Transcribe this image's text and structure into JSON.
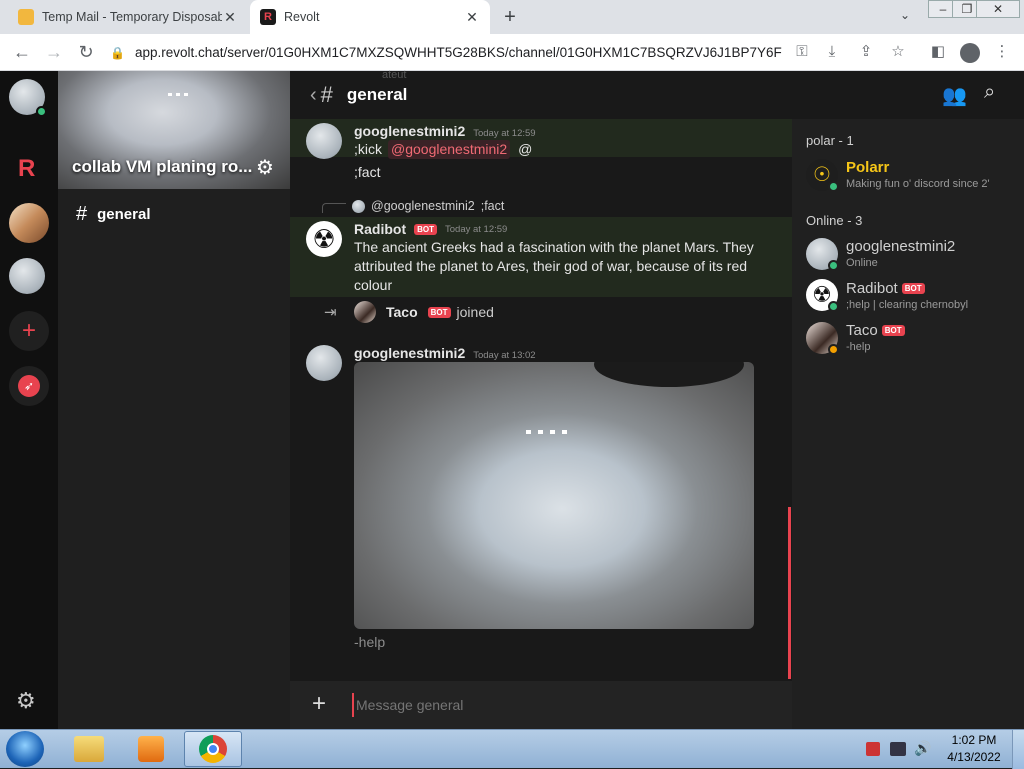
{
  "browser": {
    "tabs": [
      {
        "title": "Temp Mail - Temporary Disposable",
        "active": false
      },
      {
        "title": "Revolt",
        "active": true
      }
    ],
    "url": "app.revolt.chat/server/01G0HXM1C7MXZSQWHHT5G28BKS/channel/01G0HXM1C7BSQRZVJ6J1BP7Y6F",
    "new_tab": "+",
    "close": "✕"
  },
  "sidebar": {
    "server_name": "collab VM planing ro...",
    "channels": [
      {
        "name": "general"
      }
    ]
  },
  "channel": {
    "name": "general",
    "hash": "#",
    "back": "‹"
  },
  "messages": [
    {
      "author": "googlenestmini2",
      "time": "Today at 12:59",
      "lines": [
        ";kick",
        "@googlenestmini2",
        "@",
        ";fact"
      ]
    },
    {
      "author": "Radibot",
      "badge": "BOT",
      "time": "Today at 12:59",
      "reply_to": "@googlenestmini2",
      "reply_text": ";fact",
      "text": "The ancient Greeks had a fascination with the planet Mars. They attributed the planet to Ares, their god of war, because of its red colour"
    },
    {
      "system_user": "Taco",
      "badge": "BOT",
      "action": "joined"
    },
    {
      "author": "googlenestmini2",
      "time": "Today at 13:02",
      "text": "-help"
    }
  ],
  "scroll_peek": "ateut",
  "composer": {
    "placeholder": "Message general",
    "plus": "+"
  },
  "members": {
    "group1": "polar - 1",
    "group2": "Online - 3",
    "list": [
      {
        "name": "Polarr",
        "status": "Making fun o' discord since 2'",
        "color": "#f5c518"
      },
      {
        "name": "googlenestmini2",
        "status": "Online"
      },
      {
        "name": "Radibot",
        "badge": "BOT",
        "status": ";help | clearing chernobyl"
      },
      {
        "name": "Taco",
        "badge": "BOT",
        "status": "-help"
      }
    ]
  },
  "taskbar": {
    "time": "1:02 PM",
    "date": "4/13/2022"
  },
  "colors": {
    "accent": "#e8434f",
    "online": "#3abf7e",
    "idle": "#f39f00"
  }
}
